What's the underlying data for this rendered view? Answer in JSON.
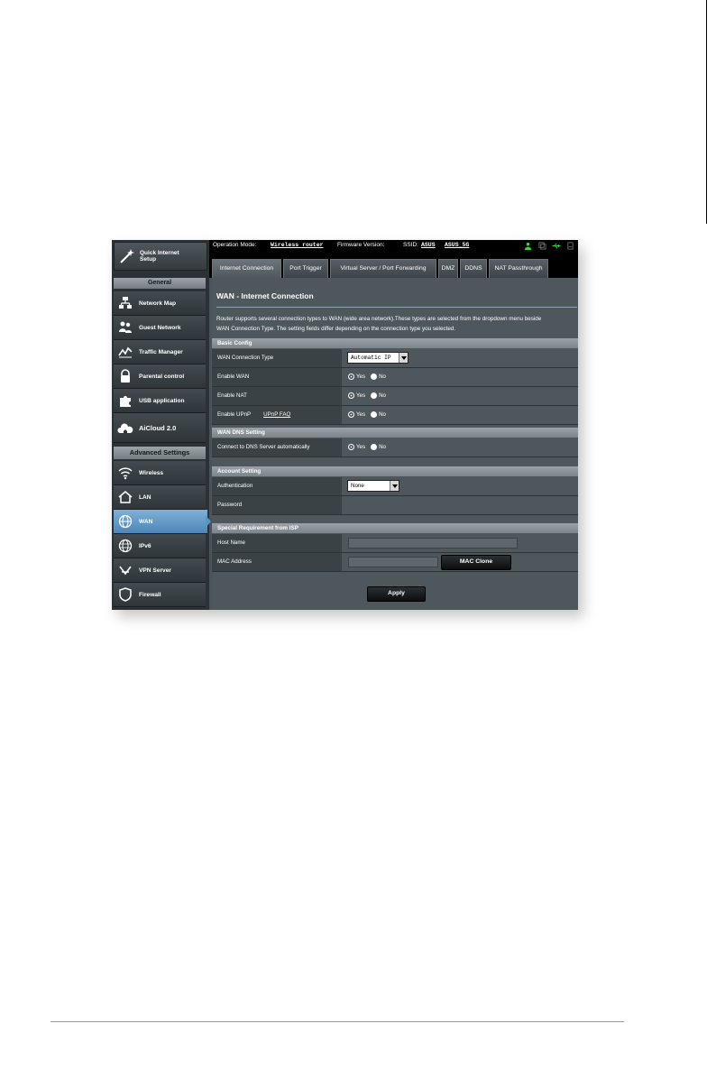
{
  "sidebar": {
    "quick_setup_label": "Quick Internet Setup",
    "general_header": "General",
    "general_items": [
      {
        "label": "Network Map",
        "icon": "network-map-icon"
      },
      {
        "label": "Guest Network",
        "icon": "guest-network-icon"
      },
      {
        "label": "Traffic Manager",
        "icon": "traffic-manager-icon"
      },
      {
        "label": "Parental control",
        "icon": "lock-icon"
      },
      {
        "label": "USB application",
        "icon": "puzzle-icon"
      },
      {
        "label": "AiCloud 2.0",
        "icon": "cloud-house-icon"
      }
    ],
    "advanced_header": "Advanced Settings",
    "advanced_items": [
      {
        "label": "Wireless",
        "icon": "wifi-icon"
      },
      {
        "label": "LAN",
        "icon": "house-icon"
      },
      {
        "label": "WAN",
        "icon": "globe-icon",
        "active": true
      },
      {
        "label": "IPv6",
        "icon": "ipv6-globe-icon"
      },
      {
        "label": "VPN Server",
        "icon": "vpn-icon"
      },
      {
        "label": "Firewall",
        "icon": "shield-icon"
      }
    ]
  },
  "topbar": {
    "op_mode_label": "Operation Mode:",
    "op_mode_value": "Wireless router",
    "firmware_label": "Firmware Version:",
    "ssid_label": "SSID:",
    "ssid_1": "ASUS",
    "ssid_2": "ASUS_5G"
  },
  "tabs": [
    {
      "label": "Internet Connection",
      "active": true
    },
    {
      "label": "Port Trigger"
    },
    {
      "label": "Virtual Server / Port Forwarding"
    },
    {
      "label": "DMZ"
    },
    {
      "label": "DDNS"
    },
    {
      "label": "NAT Passthrough"
    }
  ],
  "page": {
    "title": "WAN - Internet Connection",
    "description_line1": "Router supports several connection types to WAN (wide area network).These types are selected from the dropdown menu beside",
    "description_line2": "WAN Connection Type. The setting fields differ depending on the connection type you selected."
  },
  "sections": {
    "basic_config": {
      "header": "Basic Config",
      "wan_connection_type_label": "WAN Connection Type",
      "wan_connection_type_value": "Automatic IP",
      "enable_wan_label": "Enable WAN",
      "enable_nat_label": "Enable NAT",
      "enable_upnp_label": "Enable UPnP",
      "upnp_faq_link": "UPnP FAQ"
    },
    "wan_dns": {
      "header": "WAN DNS Setting",
      "connect_dns_label": "Connect to DNS Server automatically"
    },
    "account": {
      "header": "Account Setting",
      "authentication_label": "Authentication",
      "authentication_value": "None",
      "password_label": "Password"
    },
    "isp": {
      "header": "Special Requirement from ISP",
      "host_name_label": "Host Name",
      "host_name_value": "",
      "mac_address_label": "MAC Address",
      "mac_address_value": "",
      "mac_clone_button": "MAC Clone"
    }
  },
  "radio_labels": {
    "yes": "Yes",
    "no": "No"
  },
  "radio_values": {
    "enable_wan": "yes",
    "enable_nat": "yes",
    "enable_upnp": "yes",
    "connect_dns": "yes"
  },
  "apply_button": "Apply",
  "colors": {
    "active_nav": "#5b93c2",
    "panel_bg": "#4d575c",
    "status_green": "#3fcf3f"
  }
}
